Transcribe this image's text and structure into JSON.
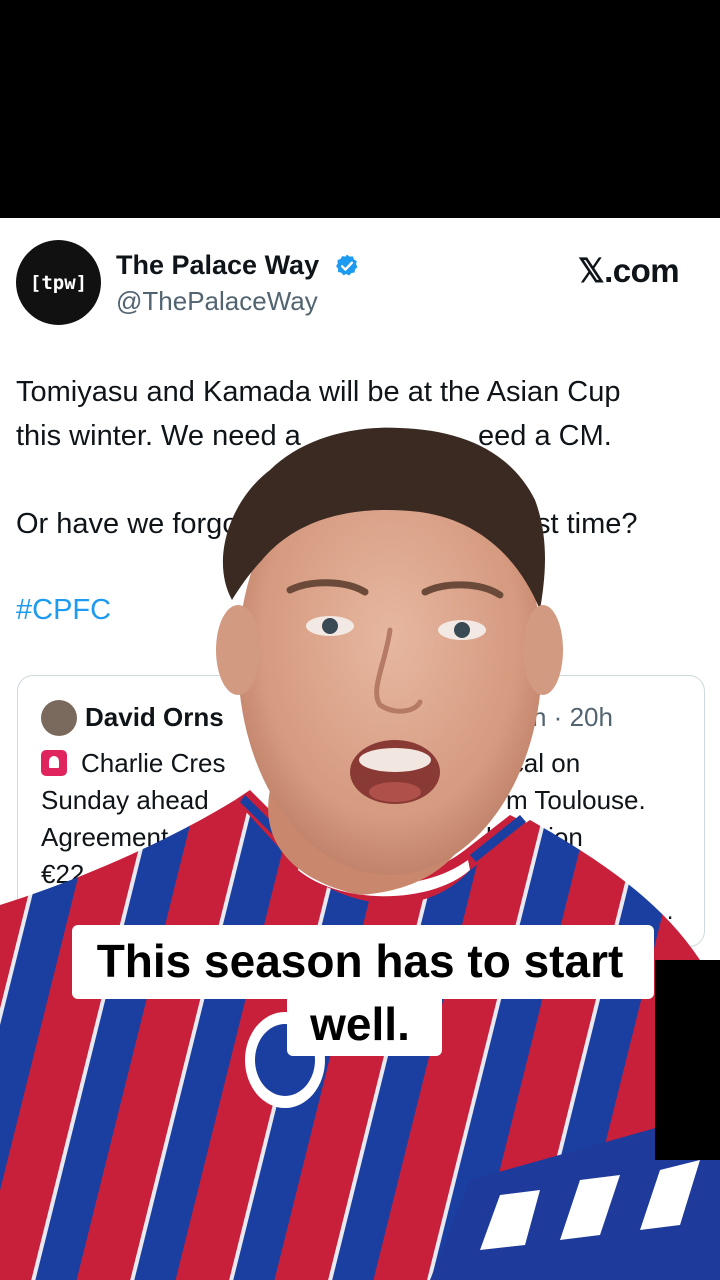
{
  "tweet": {
    "avatar_text": "[tpw]",
    "display_name": "The Palace Way",
    "handle": "@ThePalaceWay",
    "source": "𝕏.com",
    "lines": [
      "Tomiyasu and Kamada will be at the Asian Cup",
      "this winter. We need a",
      "eed a CM.",
      "Or have we forgo",
      "st time?"
    ],
    "hashtag": "#CPFC"
  },
  "quote": {
    "name": "David Orns",
    "time": "n · 20h",
    "line1_a": "Charlie Cres",
    "line1_b": "ical on",
    "line2_a": "Sunday ahead",
    "line2_b": "m Toulouse.",
    "line3_a": "Agreement",
    "line3_b": "bligation",
    "line4_a": "€22.",
    "more": "e 2..."
  },
  "caption": {
    "line1": "This season has to start",
    "line2": "well."
  },
  "colors": {
    "link": "#1d9bf0",
    "verified": "#1d9bf0",
    "jersey_red": "#c8203a",
    "jersey_blue": "#1b3fa0"
  }
}
